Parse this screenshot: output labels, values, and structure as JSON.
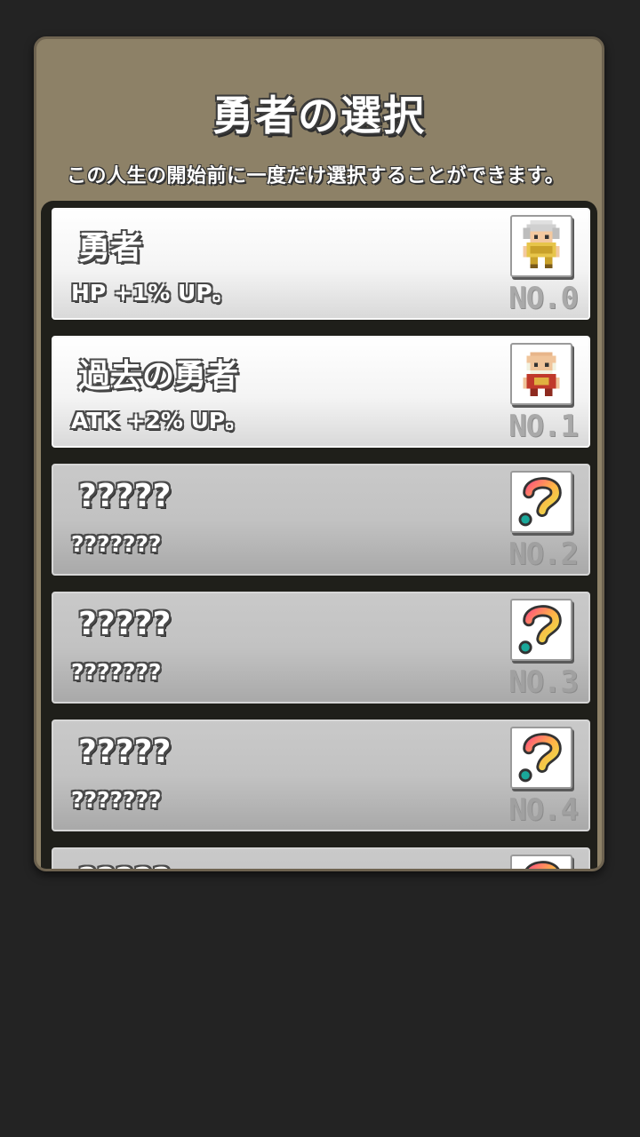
{
  "panel": {
    "title": "勇者の選択",
    "subtitle": "この人生の開始前に一度だけ選択することができます。"
  },
  "cards": [
    {
      "name": "勇者",
      "desc": "HP +1% UP。",
      "no": "NO.0",
      "locked": false,
      "icon": "white-haired-hero-icon"
    },
    {
      "name": "過去の勇者",
      "desc": "ATK +2% UP。",
      "no": "NO.1",
      "locked": false,
      "icon": "bald-elder-hero-icon"
    },
    {
      "name": "?????",
      "desc": "???????",
      "no": "NO.2",
      "locked": true,
      "icon": "question-mark-icon"
    },
    {
      "name": "?????",
      "desc": "???????",
      "no": "NO.3",
      "locked": true,
      "icon": "question-mark-icon"
    },
    {
      "name": "?????",
      "desc": "???????",
      "no": "NO.4",
      "locked": true,
      "icon": "question-mark-icon"
    },
    {
      "name": "?????",
      "desc": "",
      "no": "",
      "locked": true,
      "icon": "question-mark-icon"
    }
  ],
  "colors": {
    "background": "#232323",
    "panel": "#8d8167",
    "list_area": "#1f1f1a"
  }
}
